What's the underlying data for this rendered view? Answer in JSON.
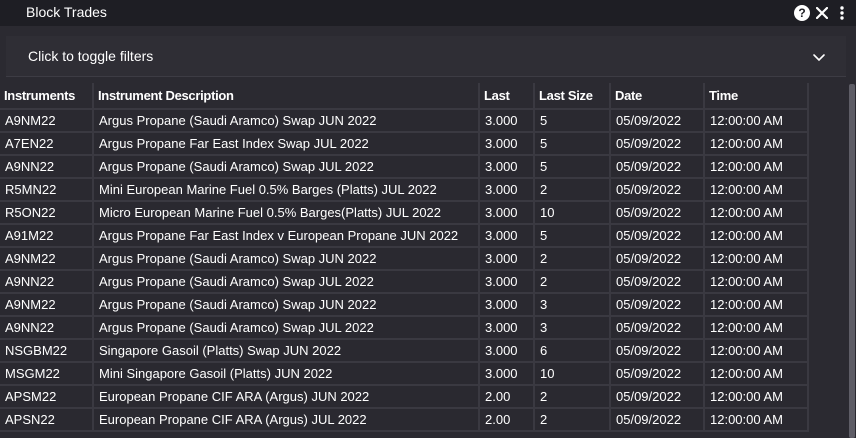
{
  "window": {
    "title": "Block Trades"
  },
  "filters": {
    "toggle_label": "Click to toggle filters"
  },
  "table": {
    "columns": [
      "Instruments",
      "Instrument Description",
      "Last",
      "Last Size",
      "Date",
      "Time"
    ],
    "rows": [
      [
        "A9NM22",
        "Argus Propane (Saudi Aramco) Swap JUN 2022",
        "3.000",
        "5",
        "05/09/2022",
        "12:00:00 AM"
      ],
      [
        "A7EN22",
        "Argus Propane Far East Index Swap JUL 2022",
        "3.000",
        "5",
        "05/09/2022",
        "12:00:00 AM"
      ],
      [
        "A9NN22",
        "Argus Propane (Saudi Aramco) Swap JUL 2022",
        "3.000",
        "5",
        "05/09/2022",
        "12:00:00 AM"
      ],
      [
        "R5MN22",
        "Mini European Marine Fuel 0.5% Barges (Platts) JUL 2022",
        "3.000",
        "2",
        "05/09/2022",
        "12:00:00 AM"
      ],
      [
        "R5ON22",
        "Micro European Marine Fuel 0.5% Barges(Platts) JUL 2022",
        "3.000",
        "10",
        "05/09/2022",
        "12:00:00 AM"
      ],
      [
        "A91M22",
        "Argus Propane Far East Index v European Propane JUN 2022",
        "3.000",
        "5",
        "05/09/2022",
        "12:00:00 AM"
      ],
      [
        "A9NM22",
        "Argus Propane (Saudi Aramco) Swap JUN 2022",
        "3.000",
        "2",
        "05/09/2022",
        "12:00:00 AM"
      ],
      [
        "A9NN22",
        "Argus Propane (Saudi Aramco) Swap JUL 2022",
        "3.000",
        "2",
        "05/09/2022",
        "12:00:00 AM"
      ],
      [
        "A9NM22",
        "Argus Propane (Saudi Aramco) Swap JUN 2022",
        "3.000",
        "3",
        "05/09/2022",
        "12:00:00 AM"
      ],
      [
        "A9NN22",
        "Argus Propane (Saudi Aramco) Swap JUL 2022",
        "3.000",
        "3",
        "05/09/2022",
        "12:00:00 AM"
      ],
      [
        "NSGBM22",
        "Singapore Gasoil (Platts) Swap JUN 2022",
        "3.000",
        "6",
        "05/09/2022",
        "12:00:00 AM"
      ],
      [
        "MSGM22",
        "Mini Singapore Gasoil (Platts) JUN 2022",
        "3.000",
        "10",
        "05/09/2022",
        "12:00:00 AM"
      ],
      [
        "APSM22",
        "European Propane CIF ARA (Argus) JUN 2022",
        "2.00",
        "2",
        "05/09/2022",
        "12:00:00 AM"
      ],
      [
        "APSN22",
        "European Propane CIF ARA (Argus) JUL 2022",
        "2.00",
        "2",
        "05/09/2022",
        "12:00:00 AM"
      ]
    ]
  },
  "icons": {
    "help": "help-icon",
    "close": "close-icon",
    "more": "more-vertical-icon",
    "expand": "chevron-down-icon"
  },
  "colors": {
    "background": "#2b2a31",
    "titlebar": "#1e1e24",
    "text": "#ffffff"
  }
}
